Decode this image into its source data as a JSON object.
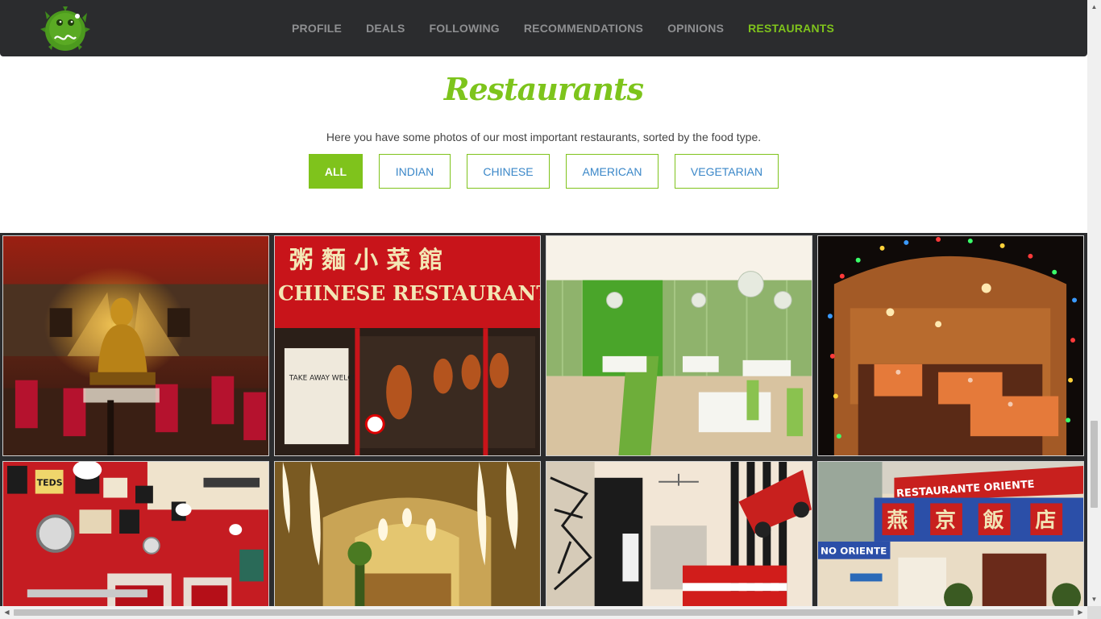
{
  "nav": {
    "items": [
      {
        "label": "PROFILE",
        "active": false
      },
      {
        "label": "DEALS",
        "active": false
      },
      {
        "label": "FOLLOWING",
        "active": false
      },
      {
        "label": "RECOMMENDATIONS",
        "active": false
      },
      {
        "label": "OPINIONS",
        "active": false
      },
      {
        "label": "RESTAURANTS",
        "active": true
      }
    ]
  },
  "section": {
    "title": "Restaurants",
    "subtitle": "Here you have some photos of our most important restaurants, sorted by the food type."
  },
  "filters": {
    "items": [
      {
        "label": "ALL",
        "active": true
      },
      {
        "label": "INDIAN",
        "active": false
      },
      {
        "label": "CHINESE",
        "active": false
      },
      {
        "label": "AMERICAN",
        "active": false
      },
      {
        "label": "VEGETARIAN",
        "active": false
      }
    ]
  },
  "gallery": {
    "photos": [
      {
        "name": "buddha-restaurant-photo",
        "text": ""
      },
      {
        "name": "chinese-restaurant-photo",
        "text": "CHINESE RESTAURANT",
        "sign": "TAKE AWAY WELCOME"
      },
      {
        "name": "green-restaurant-photo",
        "text": ""
      },
      {
        "name": "lights-restaurant-photo",
        "text": ""
      },
      {
        "name": "american-diner-photo",
        "text": "TEDS"
      },
      {
        "name": "lantern-restaurant-photo",
        "text": ""
      },
      {
        "name": "comic-diner-photo",
        "text": ""
      },
      {
        "name": "restaurante-oriente-photo",
        "text": "RESTAURANTE ORIENTE",
        "sign": "NO ORIENTE"
      }
    ]
  },
  "colors": {
    "accent": "#7fc31c",
    "navbar": "#2b2c2e",
    "link": "#3a87c8"
  }
}
